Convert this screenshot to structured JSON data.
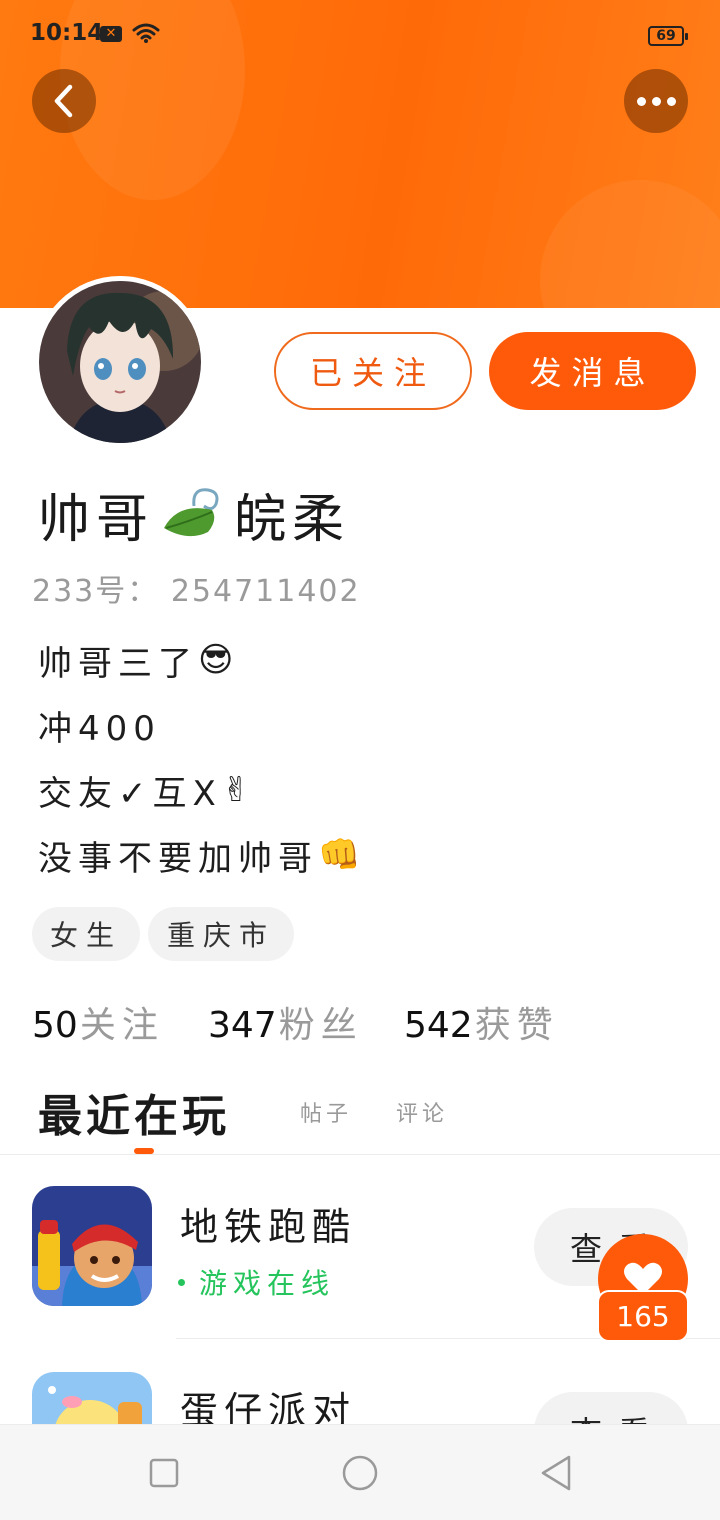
{
  "status_bar": {
    "time": "10:14",
    "battery": "69"
  },
  "profile": {
    "follow_label": "已关注",
    "message_label": "发消息",
    "username_part1": "帅哥",
    "username_part2": "皖柔",
    "uid_label": "233号：",
    "uid_value": "254711402",
    "bio": [
      {
        "text": "帅哥三了",
        "emoji": "😎"
      },
      {
        "text": "冲400",
        "emoji": ""
      },
      {
        "text": "交友✓互X",
        "emoji": "✌"
      },
      {
        "text": "没事不要加帅哥",
        "emoji": "👊"
      }
    ],
    "tags": [
      "女生",
      "重庆市"
    ]
  },
  "stats": [
    {
      "value": "50",
      "label": "关注"
    },
    {
      "value": "347",
      "label": "粉丝"
    },
    {
      "value": "542",
      "label": "获赞"
    }
  ],
  "tabs": {
    "active": "最近在玩",
    "posts": "帖子",
    "comments": "评论"
  },
  "games": [
    {
      "name": "地铁跑酷",
      "status": "游戏在线",
      "action": "查看"
    },
    {
      "name": "蛋仔派对",
      "status": "",
      "action": "查看"
    }
  ],
  "floating": {
    "like_count": "165"
  },
  "colors": {
    "brand": "#ff5a0a",
    "header": "#ff7a10",
    "online": "#25c45c"
  },
  "icons": {
    "back": "chevron-left-icon",
    "more": "more-dots-icon",
    "leaf": "leaf-icon",
    "heart": "heart-icon",
    "nav_recent": "square-icon",
    "nav_home": "circle-icon",
    "nav_back": "triangle-back-icon"
  }
}
